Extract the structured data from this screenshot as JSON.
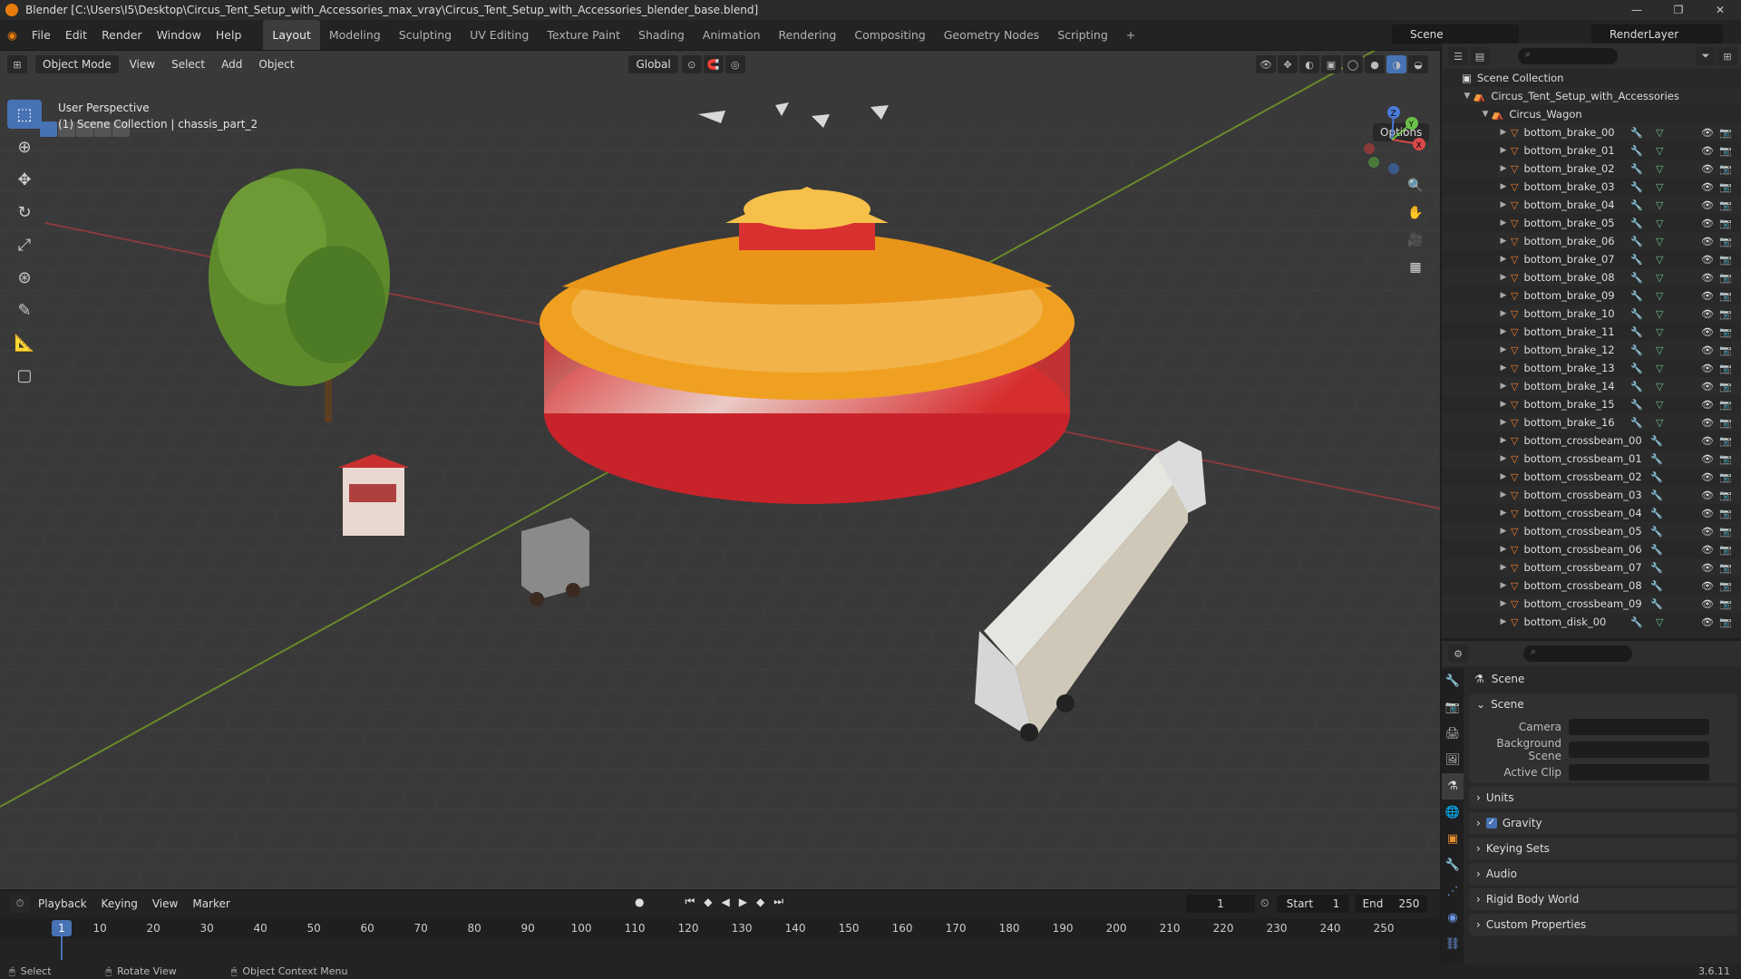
{
  "title": "Blender [C:\\Users\\I5\\Desktop\\Circus_Tent_Setup_with_Accessories_max_vray\\Circus_Tent_Setup_with_Accessories_blender_base.blend]",
  "menu": [
    "File",
    "Edit",
    "Render",
    "Window",
    "Help"
  ],
  "workspaces": [
    "Layout",
    "Modeling",
    "Sculpting",
    "UV Editing",
    "Texture Paint",
    "Shading",
    "Animation",
    "Rendering",
    "Compositing",
    "Geometry Nodes",
    "Scripting",
    "+"
  ],
  "scene_name": "Scene",
  "render_layer": "RenderLayer",
  "viewport": {
    "mode": "Object Mode",
    "menus": [
      "View",
      "Select",
      "Add",
      "Object"
    ],
    "transform": "Global",
    "options": "Options",
    "perspective": "User Perspective",
    "context": "(1) Scene Collection | chassis_part_2",
    "gizmo": {
      "z": "Z",
      "y": "Y",
      "x": "X"
    }
  },
  "outliner": {
    "root": "Scene Collection",
    "collection": "Circus_Tent_Setup_with_Accessories",
    "sub": "Circus_Wagon",
    "items": [
      {
        "name": "bottom_brake_00",
        "mesh": true
      },
      {
        "name": "bottom_brake_01",
        "mesh": true
      },
      {
        "name": "bottom_brake_02",
        "mesh": true
      },
      {
        "name": "bottom_brake_03",
        "mesh": true
      },
      {
        "name": "bottom_brake_04",
        "mesh": true
      },
      {
        "name": "bottom_brake_05",
        "mesh": true
      },
      {
        "name": "bottom_brake_06",
        "mesh": true
      },
      {
        "name": "bottom_brake_07",
        "mesh": true
      },
      {
        "name": "bottom_brake_08",
        "mesh": true
      },
      {
        "name": "bottom_brake_09",
        "mesh": true
      },
      {
        "name": "bottom_brake_10",
        "mesh": true
      },
      {
        "name": "bottom_brake_11",
        "mesh": true
      },
      {
        "name": "bottom_brake_12",
        "mesh": true
      },
      {
        "name": "bottom_brake_13",
        "mesh": true
      },
      {
        "name": "bottom_brake_14",
        "mesh": true
      },
      {
        "name": "bottom_brake_15",
        "mesh": true
      },
      {
        "name": "bottom_brake_16",
        "mesh": true
      },
      {
        "name": "bottom_crossbeam_00",
        "mesh": false
      },
      {
        "name": "bottom_crossbeam_01",
        "mesh": false
      },
      {
        "name": "bottom_crossbeam_02",
        "mesh": false
      },
      {
        "name": "bottom_crossbeam_03",
        "mesh": false
      },
      {
        "name": "bottom_crossbeam_04",
        "mesh": false
      },
      {
        "name": "bottom_crossbeam_05",
        "mesh": false
      },
      {
        "name": "bottom_crossbeam_06",
        "mesh": false
      },
      {
        "name": "bottom_crossbeam_07",
        "mesh": false
      },
      {
        "name": "bottom_crossbeam_08",
        "mesh": false
      },
      {
        "name": "bottom_crossbeam_09",
        "mesh": false
      },
      {
        "name": "bottom_disk_00",
        "mesh": true
      }
    ]
  },
  "properties": {
    "title": "Scene",
    "scene_panel": "Scene",
    "fields": [
      "Camera",
      "Background Scene",
      "Active Clip"
    ],
    "collapsed": [
      "Units",
      "Gravity",
      "Keying Sets",
      "Audio",
      "Rigid Body World",
      "Custom Properties"
    ]
  },
  "timeline": {
    "menus": [
      "Playback",
      "Keying",
      "View",
      "Marker"
    ],
    "current_frame": "1",
    "start_label": "Start",
    "start": "1",
    "end_label": "End",
    "end": "250",
    "ticks": [
      "1",
      "10",
      "20",
      "30",
      "40",
      "50",
      "60",
      "70",
      "80",
      "90",
      "100",
      "110",
      "120",
      "130",
      "140",
      "150",
      "160",
      "170",
      "180",
      "190",
      "200",
      "210",
      "220",
      "230",
      "240",
      "250"
    ]
  },
  "status": {
    "select": "Select",
    "rotate": "Rotate View",
    "context": "Object Context Menu",
    "version": "3.6.11"
  }
}
